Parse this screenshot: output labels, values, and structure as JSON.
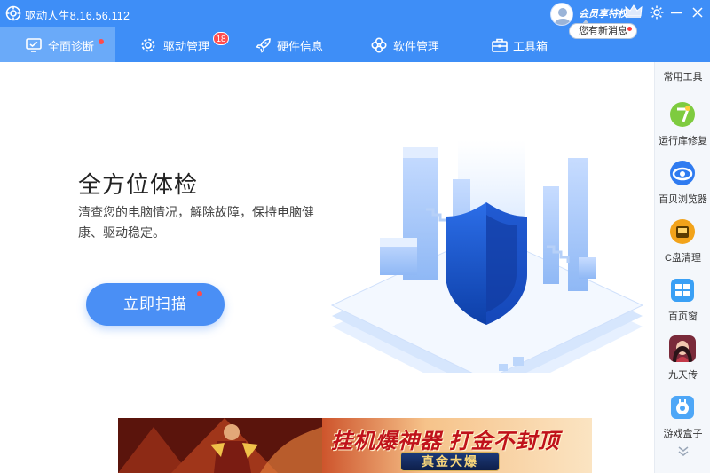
{
  "titlebar": {
    "app_title": "驱动人生8.16.56.112",
    "vip_label": "会员享特权",
    "message_bubble": "您有新消息"
  },
  "nav": {
    "tabs": [
      {
        "label": "全面诊断",
        "icon": "monitor-check-icon",
        "active": true
      },
      {
        "label": "驱动管理",
        "icon": "gear-icon",
        "badge": "18"
      },
      {
        "label": "硬件信息",
        "icon": "rocket-icon"
      },
      {
        "label": "软件管理",
        "icon": "clover-icon"
      },
      {
        "label": "工具箱",
        "icon": "toolbox-icon"
      }
    ]
  },
  "main": {
    "headline": "全方位体检",
    "description": "清查您的电脑情况，解除故障，保持电脑健康、驱动稳定。",
    "scan_button": "立即扫描"
  },
  "ad": {
    "title": "挂机爆神器 打金不封顶",
    "subtitle": "真金大爆"
  },
  "sidebar": {
    "title": "常用工具",
    "items": [
      {
        "label": "运行库修复",
        "icon": "runtime-repair-icon"
      },
      {
        "label": "百贝浏览器",
        "icon": "browser-icon"
      },
      {
        "label": "C盘清理",
        "icon": "disk-clean-icon"
      },
      {
        "label": "百页窗",
        "icon": "window-icon"
      },
      {
        "label": "九天传",
        "icon": "game-avatar-icon"
      },
      {
        "label": "游戏盒子",
        "icon": "game-box-icon"
      }
    ]
  },
  "colors": {
    "primary": "#3e8ef7",
    "active_tab": "#6aaaf9",
    "scan_button": "#4a8ff5",
    "badge": "#ff4d4f"
  }
}
